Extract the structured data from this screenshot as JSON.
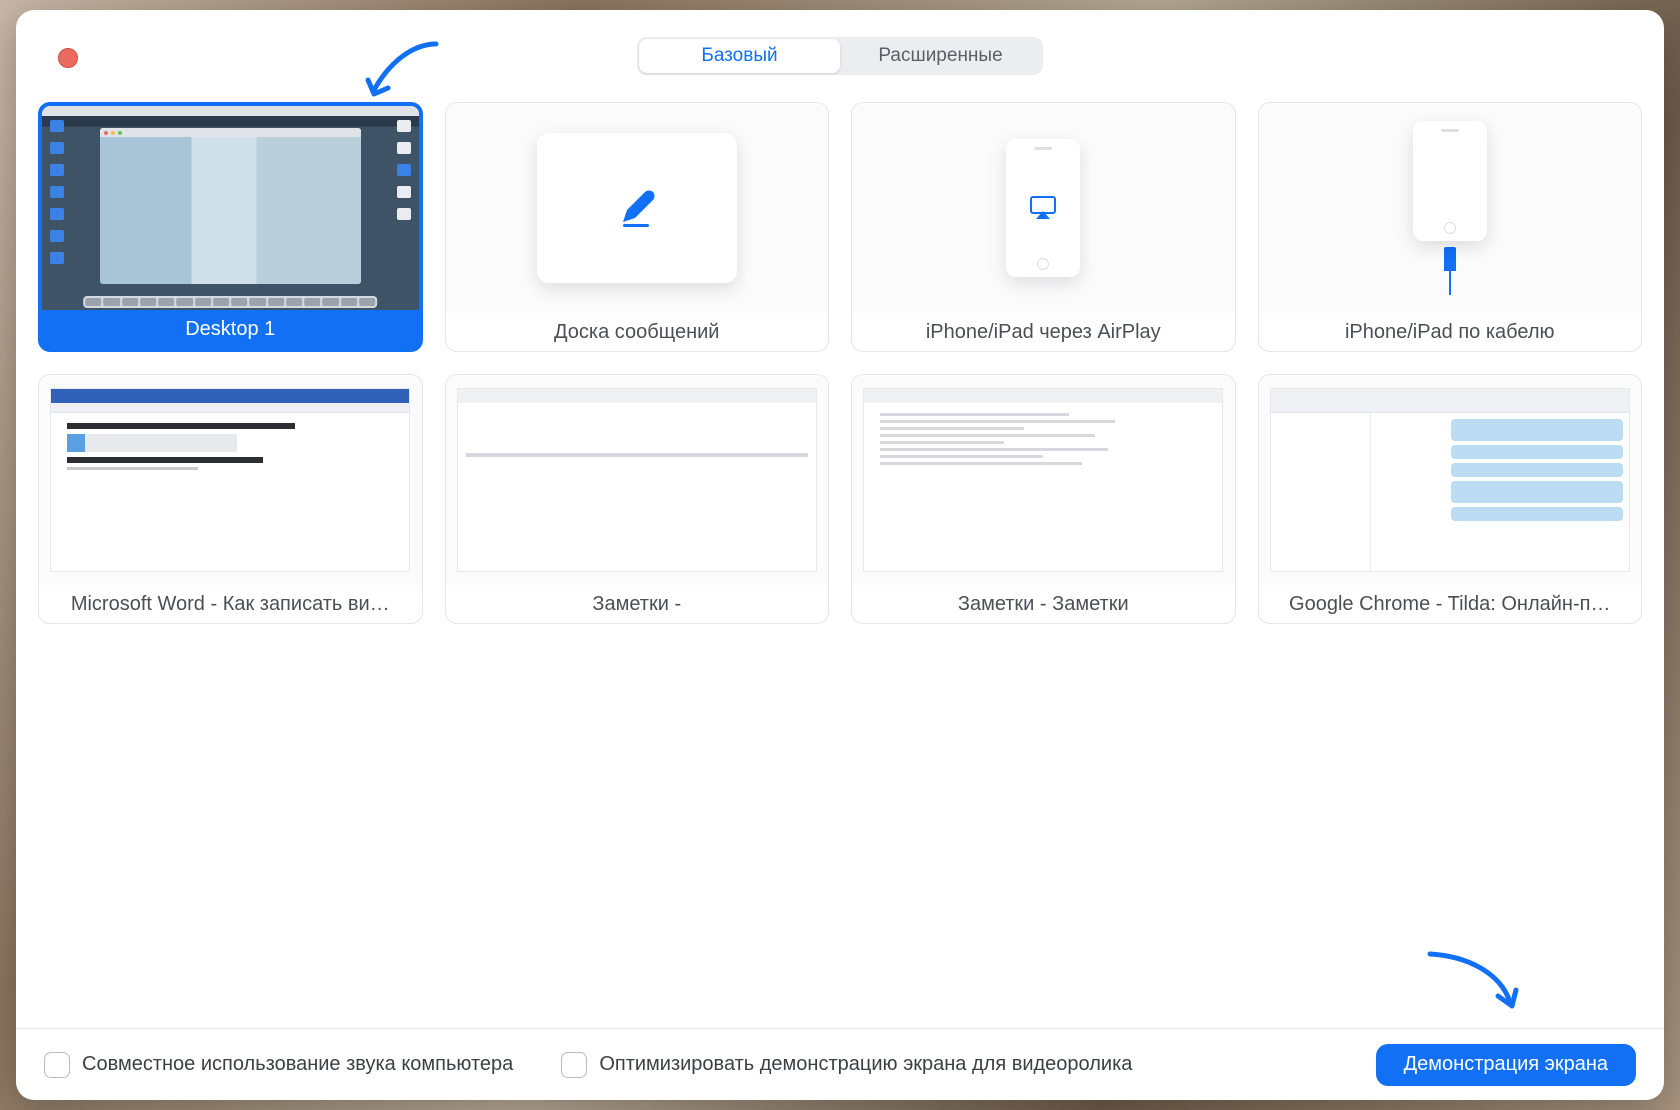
{
  "segmented": {
    "basic": "Базовый",
    "advanced": "Расширенные"
  },
  "tiles": {
    "desktop1": "Desktop 1",
    "whiteboard": "Доска сообщений",
    "airplay": "iPhone/iPad через AirPlay",
    "cable": "iPhone/iPad по кабелю",
    "word": "Microsoft Word - Как записать ви…",
    "notes1": "Заметки -",
    "notes2": "Заметки - Заметки",
    "chrome": "Google Chrome - Tilda: Онлайн-п…"
  },
  "footer": {
    "share_audio": "Совместное использование звука компьютера",
    "optimize_video": "Оптимизировать демонстрацию экрана для видеоролика",
    "share_button": "Демонстрация экрана"
  },
  "colors": {
    "accent": "#1170f4",
    "close": "#ea6a5e"
  }
}
